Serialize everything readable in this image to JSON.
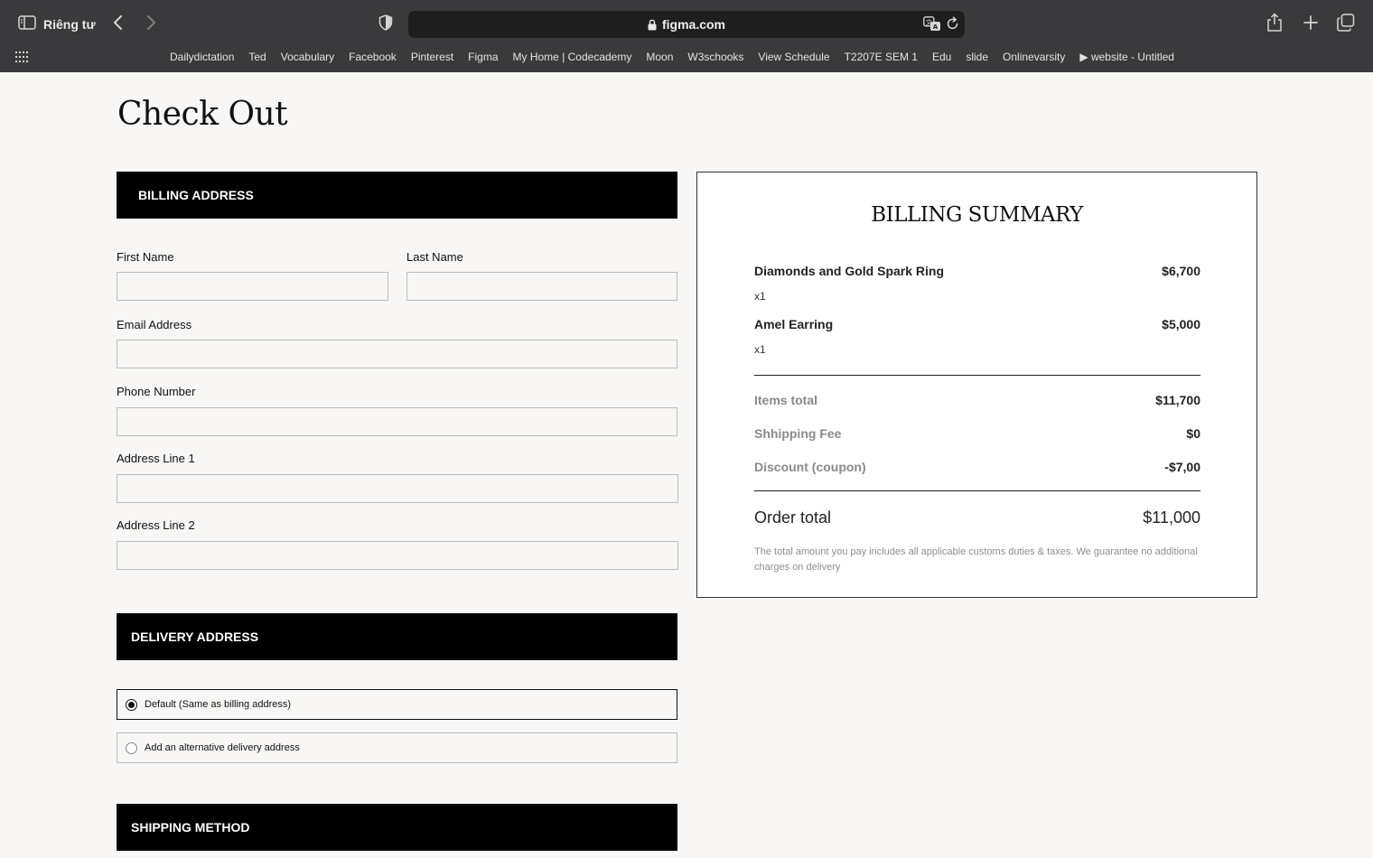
{
  "browser": {
    "private_label": "Riêng tư",
    "url": "figma.com",
    "bookmarks": [
      "Dailydictation",
      "Ted",
      "Vocabulary",
      "Facebook",
      "Pinterest",
      "Figma",
      "My Home | Codecademy",
      "Moon",
      "W3schooks",
      "View Schedule",
      "T2207E SEM 1",
      "Edu",
      "slide",
      "Onlinevarsity",
      "▶ website - Untitled"
    ]
  },
  "page": {
    "title": "Check Out"
  },
  "billing": {
    "header": "BILLING ADDRESS",
    "first_name_label": "First Name",
    "last_name_label": "Last Name",
    "email_label": "Email Address",
    "phone_label": "Phone Number",
    "address1_label": "Address Line 1",
    "address2_label": "Address Line 2",
    "first_name_value": "",
    "last_name_value": "",
    "email_value": "",
    "phone_value": "",
    "address1_value": "",
    "address2_value": ""
  },
  "delivery": {
    "header": "DELIVERY ADDRESS",
    "options": [
      {
        "label": "Default (Same as billing address)",
        "selected": true
      },
      {
        "label": "Add an alternative delivery address",
        "selected": false
      }
    ]
  },
  "shipping": {
    "header": "SHIPPING METHOD"
  },
  "summary": {
    "title": "BILLING SUMMARY",
    "items": [
      {
        "name": "Diamonds and Gold Spark Ring",
        "price": "$6,700",
        "qty": "x1"
      },
      {
        "name": "Amel Earring",
        "price": "$5,000",
        "qty": "x1"
      }
    ],
    "items_total_label": "Items total",
    "items_total_value": "$11,700",
    "shipping_fee_label": "Shhipping Fee",
    "shipping_fee_value": "$0",
    "discount_label": "Discount (coupon)",
    "discount_value": "-$7,00",
    "order_total_label": "Order total",
    "order_total_value": "$11,000",
    "note": "The total amount you pay includes all applicable customs duties & taxes. We guarantee no additional charges on delivery"
  }
}
